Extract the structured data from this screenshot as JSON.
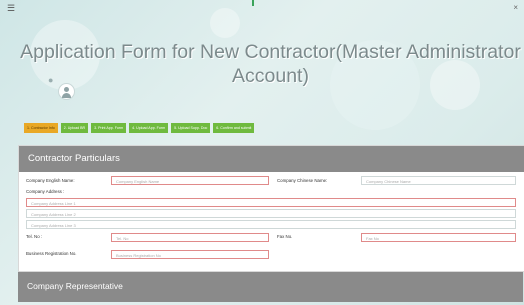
{
  "window": {
    "menu_icon": "hamburger-icon",
    "close_icon": "close-icon",
    "close_glyph": "×"
  },
  "title": {
    "line1": "Application Form for New Contractor(Master Administrator",
    "line2": "Account)"
  },
  "steps": [
    {
      "label": "1. Contractor Info",
      "active": true
    },
    {
      "label": "2. Upload BR",
      "active": false
    },
    {
      "label": "3. Print App. Form",
      "active": false
    },
    {
      "label": "4. Upload App. Form",
      "active": false
    },
    {
      "label": "5. Upload Supp. Doc",
      "active": false
    },
    {
      "label": "6. Confirm and submit",
      "active": false
    }
  ],
  "contractor": {
    "heading": "Contractor Particulars",
    "company_english_name": {
      "label": "Company English Name:",
      "placeholder": "Company English Name"
    },
    "company_chinese_name": {
      "label": "Company Chinese Name:",
      "placeholder": "Company Chinese Name"
    },
    "company_address": {
      "label": "Company Address :",
      "line1": "Company Address Line 1",
      "line2": "Company Address Line 2",
      "line3": "Company Address Line 3"
    },
    "tel": {
      "label": "Tel. No :",
      "placeholder": "Tel. No"
    },
    "fax": {
      "label": "Fax No.",
      "placeholder": "Fax No"
    },
    "br": {
      "label": "Business Registration No.",
      "placeholder": "Business Registration No"
    }
  },
  "representative": {
    "heading": "Company Representative"
  }
}
